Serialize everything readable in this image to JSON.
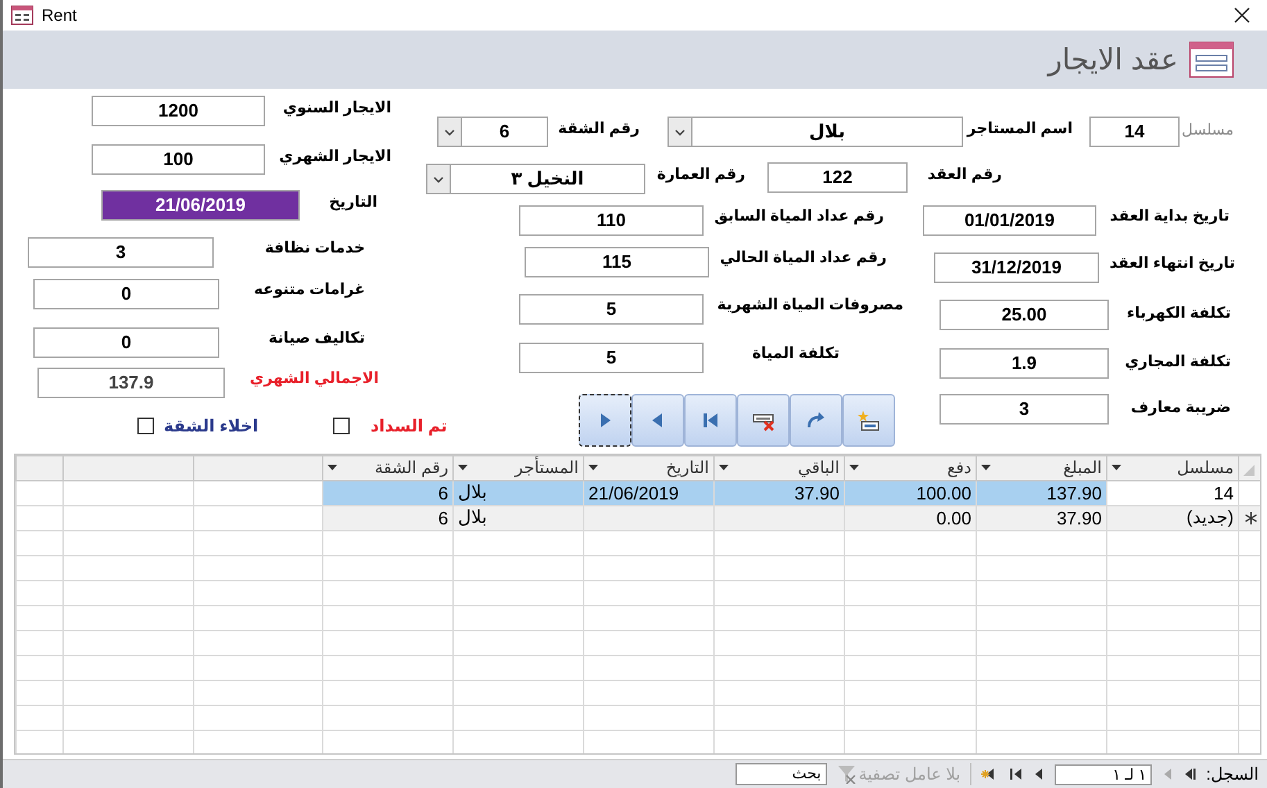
{
  "window": {
    "title": "Rent"
  },
  "header": {
    "title": "عقد الايجار"
  },
  "fields": [
    {
      "label": "مسلسل",
      "value": "14",
      "kind": "text",
      "color": "#8c8c8c"
    },
    {
      "label": "اسم المستاجر",
      "value": "بلال",
      "kind": "combo"
    },
    {
      "label": "رقم الشقة",
      "value": "6",
      "kind": "combo"
    },
    {
      "label": "الايجار السنوي",
      "value": "1200",
      "kind": "text"
    },
    {
      "label": "الايجار الشهري",
      "value": "100",
      "kind": "text"
    },
    {
      "label": "رقم العقد",
      "value": "122",
      "kind": "text"
    },
    {
      "label": "رقم العمارة",
      "value": "النخيل ٣",
      "kind": "combo"
    },
    {
      "label": "التاريخ",
      "value": "21/06/2019",
      "kind": "highlighted"
    },
    {
      "label": "تاريخ بداية العقد",
      "value": "01/01/2019",
      "kind": "text"
    },
    {
      "label": "رقم عداد المياة السابق",
      "value": "110",
      "kind": "text"
    },
    {
      "label": "خدمات نظافة",
      "value": "3",
      "kind": "text"
    },
    {
      "label": "تاريخ انتهاء العقد",
      "value": "31/12/2019",
      "kind": "text"
    },
    {
      "label": "رقم عداد المياة الحالي",
      "value": "115",
      "kind": "text"
    },
    {
      "label": "غرامات متنوعه",
      "value": "0",
      "kind": "text"
    },
    {
      "label": "تكلفة الكهرباء",
      "value": "25.00",
      "kind": "text"
    },
    {
      "label": "مصروفات المياة  الشهرية",
      "value": "5",
      "kind": "text"
    },
    {
      "label": "تكاليف صيانة",
      "value": "0",
      "kind": "text"
    },
    {
      "label": "تكلفة المجاري",
      "value": "1.9",
      "kind": "text"
    },
    {
      "label": "تكلفة المياة",
      "value": "5",
      "kind": "text"
    },
    {
      "label": "الاجمالي الشهري",
      "value": "137.9",
      "kind": "total",
      "color": "#e8202a"
    },
    {
      "label": "ضريبة معارف",
      "value": "3",
      "kind": "text"
    }
  ],
  "checkboxes": [
    {
      "label": "تم السداد",
      "checked": false,
      "color": "#e8202a"
    },
    {
      "label": "اخلاء الشقة",
      "checked": false,
      "color": "#2b3a8c"
    }
  ],
  "nav_buttons": [
    {
      "kind": "next",
      "focused": true
    },
    {
      "kind": "previous",
      "focused": false
    },
    {
      "kind": "first",
      "focused": false
    },
    {
      "kind": "delete",
      "focused": false
    },
    {
      "kind": "redo",
      "focused": false
    },
    {
      "kind": "new",
      "focused": false
    }
  ],
  "table": {
    "columns": [
      "مسلسل",
      "المبلغ",
      "دفع",
      "الباقي",
      "التاريخ",
      "المستأجر",
      "رقم الشقة"
    ],
    "rows": [
      {
        "kind": "record",
        "selected": true,
        "cells": [
          "14",
          "137.90",
          "100.00",
          "37.90",
          "21/06/2019",
          "بلال",
          "6"
        ]
      },
      {
        "kind": "new",
        "selected": false,
        "cells": [
          "(جديد)",
          "37.90",
          "0.00",
          "",
          "",
          "بلال",
          "6"
        ]
      }
    ]
  },
  "status_bar": {
    "record_label": "السجل:",
    "position": "١ لـ ١",
    "filter": "بلا عامل تصفية",
    "search_placeholder": "بحث"
  }
}
